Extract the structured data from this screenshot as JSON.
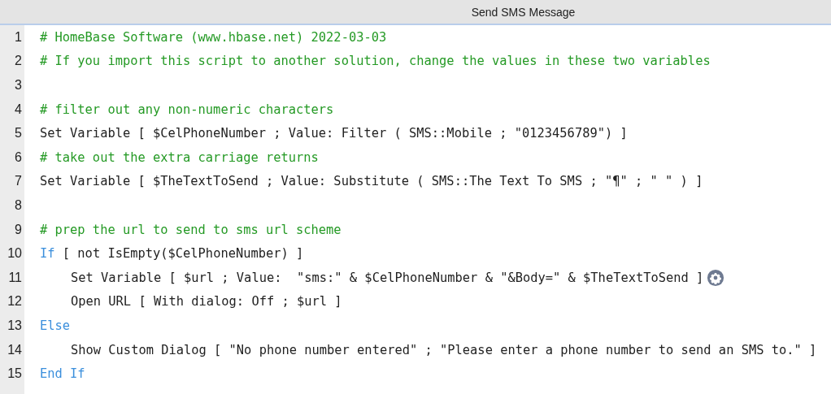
{
  "window": {
    "title": "Send SMS Message"
  },
  "lines": [
    {
      "number": "1",
      "kind": "comment",
      "text": "# HomeBase Software (www.hbase.net) 2022-03-03",
      "gear": false
    },
    {
      "number": "2",
      "kind": "comment",
      "text": "# If you import this script to another solution, change the values in these two variables",
      "gear": false
    },
    {
      "number": "3",
      "kind": "blank",
      "gear": false
    },
    {
      "number": "4",
      "kind": "comment",
      "text": "# filter out any non-numeric characters",
      "gear": false
    },
    {
      "number": "5",
      "kind": "step",
      "text": "Set Variable [ $CelPhoneNumber ; Value: Filter ( SMS::Mobile ; \"0123456789\") ]",
      "gear": false
    },
    {
      "number": "6",
      "kind": "comment",
      "text": "# take out the extra carriage returns",
      "gear": false
    },
    {
      "number": "7",
      "kind": "step",
      "text": "Set Variable [ $TheTextToSend ; Value: Substitute ( SMS::The Text To SMS ; \"¶\" ; \" \" ) ]",
      "gear": false
    },
    {
      "number": "8",
      "kind": "blank",
      "gear": false
    },
    {
      "number": "9",
      "kind": "comment",
      "text": "# prep the url to send to sms url scheme",
      "gear": false
    },
    {
      "number": "10",
      "kind": "control",
      "text": "If",
      "rest": " [ not IsEmpty($CelPhoneNumber) ]",
      "gear": false,
      "children": [
        {
          "number": "11",
          "kind": "step",
          "text": "Set Variable [ $url ; Value:  \"sms:\" & $CelPhoneNumber & \"&Body=\" & $TheTextToSend ]",
          "gear": true
        },
        {
          "number": "12",
          "kind": "step",
          "text": "Open URL [ With dialog: Off ; $url ]",
          "gear": false
        }
      ]
    },
    {
      "number": "13",
      "kind": "control",
      "text": "Else",
      "gear": false,
      "children": [
        {
          "number": "14",
          "kind": "step",
          "text": "Show Custom Dialog [ \"No phone number entered\" ; \"Please enter a phone number to send an SMS to.\" ]",
          "gear": false
        }
      ]
    },
    {
      "number": "15",
      "kind": "control",
      "text": "End If",
      "gear": false
    }
  ]
}
